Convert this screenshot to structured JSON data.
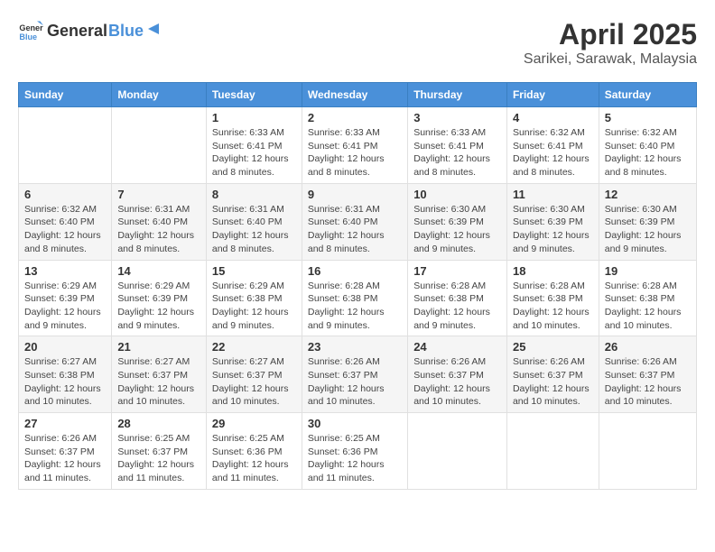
{
  "header": {
    "logo_general": "General",
    "logo_blue": "Blue",
    "title": "April 2025",
    "subtitle": "Sarikei, Sarawak, Malaysia"
  },
  "calendar": {
    "columns": [
      "Sunday",
      "Monday",
      "Tuesday",
      "Wednesday",
      "Thursday",
      "Friday",
      "Saturday"
    ],
    "rows": [
      [
        {
          "day": "",
          "info": ""
        },
        {
          "day": "",
          "info": ""
        },
        {
          "day": "1",
          "info": "Sunrise: 6:33 AM\nSunset: 6:41 PM\nDaylight: 12 hours and 8 minutes."
        },
        {
          "day": "2",
          "info": "Sunrise: 6:33 AM\nSunset: 6:41 PM\nDaylight: 12 hours and 8 minutes."
        },
        {
          "day": "3",
          "info": "Sunrise: 6:33 AM\nSunset: 6:41 PM\nDaylight: 12 hours and 8 minutes."
        },
        {
          "day": "4",
          "info": "Sunrise: 6:32 AM\nSunset: 6:41 PM\nDaylight: 12 hours and 8 minutes."
        },
        {
          "day": "5",
          "info": "Sunrise: 6:32 AM\nSunset: 6:40 PM\nDaylight: 12 hours and 8 minutes."
        }
      ],
      [
        {
          "day": "6",
          "info": "Sunrise: 6:32 AM\nSunset: 6:40 PM\nDaylight: 12 hours and 8 minutes."
        },
        {
          "day": "7",
          "info": "Sunrise: 6:31 AM\nSunset: 6:40 PM\nDaylight: 12 hours and 8 minutes."
        },
        {
          "day": "8",
          "info": "Sunrise: 6:31 AM\nSunset: 6:40 PM\nDaylight: 12 hours and 8 minutes."
        },
        {
          "day": "9",
          "info": "Sunrise: 6:31 AM\nSunset: 6:40 PM\nDaylight: 12 hours and 8 minutes."
        },
        {
          "day": "10",
          "info": "Sunrise: 6:30 AM\nSunset: 6:39 PM\nDaylight: 12 hours and 9 minutes."
        },
        {
          "day": "11",
          "info": "Sunrise: 6:30 AM\nSunset: 6:39 PM\nDaylight: 12 hours and 9 minutes."
        },
        {
          "day": "12",
          "info": "Sunrise: 6:30 AM\nSunset: 6:39 PM\nDaylight: 12 hours and 9 minutes."
        }
      ],
      [
        {
          "day": "13",
          "info": "Sunrise: 6:29 AM\nSunset: 6:39 PM\nDaylight: 12 hours and 9 minutes."
        },
        {
          "day": "14",
          "info": "Sunrise: 6:29 AM\nSunset: 6:39 PM\nDaylight: 12 hours and 9 minutes."
        },
        {
          "day": "15",
          "info": "Sunrise: 6:29 AM\nSunset: 6:38 PM\nDaylight: 12 hours and 9 minutes."
        },
        {
          "day": "16",
          "info": "Sunrise: 6:28 AM\nSunset: 6:38 PM\nDaylight: 12 hours and 9 minutes."
        },
        {
          "day": "17",
          "info": "Sunrise: 6:28 AM\nSunset: 6:38 PM\nDaylight: 12 hours and 9 minutes."
        },
        {
          "day": "18",
          "info": "Sunrise: 6:28 AM\nSunset: 6:38 PM\nDaylight: 12 hours and 10 minutes."
        },
        {
          "day": "19",
          "info": "Sunrise: 6:28 AM\nSunset: 6:38 PM\nDaylight: 12 hours and 10 minutes."
        }
      ],
      [
        {
          "day": "20",
          "info": "Sunrise: 6:27 AM\nSunset: 6:38 PM\nDaylight: 12 hours and 10 minutes."
        },
        {
          "day": "21",
          "info": "Sunrise: 6:27 AM\nSunset: 6:37 PM\nDaylight: 12 hours and 10 minutes."
        },
        {
          "day": "22",
          "info": "Sunrise: 6:27 AM\nSunset: 6:37 PM\nDaylight: 12 hours and 10 minutes."
        },
        {
          "day": "23",
          "info": "Sunrise: 6:26 AM\nSunset: 6:37 PM\nDaylight: 12 hours and 10 minutes."
        },
        {
          "day": "24",
          "info": "Sunrise: 6:26 AM\nSunset: 6:37 PM\nDaylight: 12 hours and 10 minutes."
        },
        {
          "day": "25",
          "info": "Sunrise: 6:26 AM\nSunset: 6:37 PM\nDaylight: 12 hours and 10 minutes."
        },
        {
          "day": "26",
          "info": "Sunrise: 6:26 AM\nSunset: 6:37 PM\nDaylight: 12 hours and 10 minutes."
        }
      ],
      [
        {
          "day": "27",
          "info": "Sunrise: 6:26 AM\nSunset: 6:37 PM\nDaylight: 12 hours and 11 minutes."
        },
        {
          "day": "28",
          "info": "Sunrise: 6:25 AM\nSunset: 6:37 PM\nDaylight: 12 hours and 11 minutes."
        },
        {
          "day": "29",
          "info": "Sunrise: 6:25 AM\nSunset: 6:36 PM\nDaylight: 12 hours and 11 minutes."
        },
        {
          "day": "30",
          "info": "Sunrise: 6:25 AM\nSunset: 6:36 PM\nDaylight: 12 hours and 11 minutes."
        },
        {
          "day": "",
          "info": ""
        },
        {
          "day": "",
          "info": ""
        },
        {
          "day": "",
          "info": ""
        }
      ]
    ]
  }
}
